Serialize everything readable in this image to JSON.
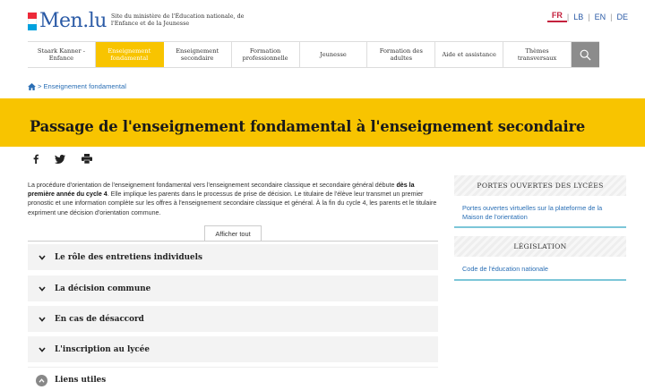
{
  "header": {
    "logo_text": "Men.lu",
    "tagline": "Site du ministère de l'Éducation nationale, de l'Enfance et de la Jeunesse",
    "flag_colors": [
      "#ed2939",
      "#ffffff",
      "#00a1de"
    ],
    "languages": [
      {
        "code": "FR",
        "active": true
      },
      {
        "code": "LB",
        "active": false
      },
      {
        "code": "EN",
        "active": false
      },
      {
        "code": "DE",
        "active": false
      }
    ],
    "lang_separator": "|"
  },
  "nav": {
    "items": [
      {
        "label": "Staark Kanner - Enfance"
      },
      {
        "label": "Enseignement fondamental",
        "active": true
      },
      {
        "label": "Enseignement secondaire"
      },
      {
        "label": "Formation professionnelle"
      },
      {
        "label": "Jeunesse"
      },
      {
        "label": "Formation des adultes"
      },
      {
        "label": "Aide et assistance"
      },
      {
        "label": "Thèmes transversaux"
      }
    ],
    "search_icon": "search-icon"
  },
  "breadcrumb": {
    "separator": ">",
    "current": "Enseignement fondamental"
  },
  "page": {
    "title": "Passage de l'enseignement fondamental à l'enseignement secondaire",
    "accent_color": "#f8c400"
  },
  "share": {
    "icons": [
      "facebook-icon",
      "twitter-icon",
      "print-icon"
    ]
  },
  "intro": {
    "part1": "La procédure d'orientation de l'enseignement fondamental vers l'enseignement secondaire classique et secondaire général débute ",
    "bold": "dès la première année du  cycle 4",
    "part2": ". Elle implique les parents dans le processus de prise de décision. Le titulaire de l'élève leur transmet un premier pronostic et une information complète sur les offres à l'enseignement secondaire classique et général. À la fin du cycle 4, les parents et le titulaire expriment une décision d'orientation commune."
  },
  "accordion": {
    "show_all_label": "Afficher tout",
    "items": [
      {
        "label": "Le rôle des entretiens individuels",
        "open": false
      },
      {
        "label": "La décision commune",
        "open": false
      },
      {
        "label": "En cas de désaccord",
        "open": false
      },
      {
        "label": "L'inscription au lycée",
        "open": false
      },
      {
        "label": "Liens utiles",
        "open": true
      }
    ]
  },
  "sidebar": {
    "sections": [
      {
        "heading": "PORTES OUVERTES DES LYCÉES",
        "links": [
          "Portes ouvertes virtuelles sur la plateforme de la Maison de l'orientation"
        ]
      },
      {
        "heading": "LÉGISLATION",
        "links": [
          "Code de l'éducation nationale"
        ]
      }
    ],
    "accent_color": "#7cc6d8"
  }
}
